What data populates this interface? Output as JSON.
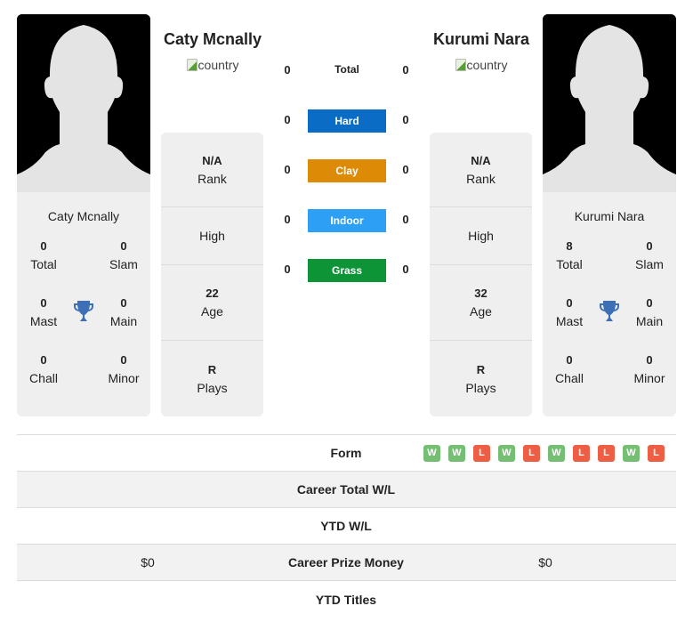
{
  "colors": {
    "hard": "#0a6cc4",
    "clay": "#dd8b06",
    "indoor": "#2da0f5",
    "grass": "#0c9437",
    "win": "#74bf74",
    "loss": "#ee5e44",
    "trophy": "#3d6fb6"
  },
  "players": [
    {
      "name": "Caty Mcnally",
      "country_alt": "country",
      "card_name": "Caty Mcnally",
      "titles": {
        "total": {
          "value": "0",
          "label": "Total"
        },
        "slam": {
          "value": "0",
          "label": "Slam"
        },
        "mast": {
          "value": "0",
          "label": "Mast"
        },
        "main": {
          "value": "0",
          "label": "Main"
        },
        "chall": {
          "value": "0",
          "label": "Chall"
        },
        "minor": {
          "value": "0",
          "label": "Minor"
        }
      },
      "info": {
        "rank": {
          "value": "N/A",
          "label": "Rank"
        },
        "high": {
          "value": "",
          "label": "High"
        },
        "age": {
          "value": "22",
          "label": "Age"
        },
        "plays": {
          "value": "R",
          "label": "Plays"
        }
      }
    },
    {
      "name": "Kurumi Nara",
      "country_alt": "country",
      "card_name": "Kurumi Nara",
      "titles": {
        "total": {
          "value": "8",
          "label": "Total"
        },
        "slam": {
          "value": "0",
          "label": "Slam"
        },
        "mast": {
          "value": "0",
          "label": "Mast"
        },
        "main": {
          "value": "0",
          "label": "Main"
        },
        "chall": {
          "value": "0",
          "label": "Chall"
        },
        "minor": {
          "value": "0",
          "label": "Minor"
        }
      },
      "info": {
        "rank": {
          "value": "N/A",
          "label": "Rank"
        },
        "high": {
          "value": "",
          "label": "High"
        },
        "age": {
          "value": "32",
          "label": "Age"
        },
        "plays": {
          "value": "R",
          "label": "Plays"
        }
      }
    }
  ],
  "h2h": {
    "total": {
      "label": "Total",
      "left": "0",
      "right": "0"
    },
    "hard": {
      "label": "Hard",
      "left": "0",
      "right": "0"
    },
    "clay": {
      "label": "Clay",
      "left": "0",
      "right": "0"
    },
    "indoor": {
      "label": "Indoor",
      "left": "0",
      "right": "0"
    },
    "grass": {
      "label": "Grass",
      "left": "0",
      "right": "0"
    }
  },
  "stats": {
    "form": {
      "label": "Form",
      "results": [
        "W",
        "W",
        "L",
        "W",
        "L",
        "W",
        "L",
        "L",
        "W",
        "L"
      ]
    },
    "career_wl": {
      "label": "Career Total W/L",
      "left": "",
      "right": ""
    },
    "ytd_wl": {
      "label": "YTD W/L",
      "left": "",
      "right": ""
    },
    "prize": {
      "label": "Career Prize Money",
      "left": "$0",
      "right": "$0"
    },
    "ytd_titles": {
      "label": "YTD Titles",
      "left": "",
      "right": ""
    }
  }
}
